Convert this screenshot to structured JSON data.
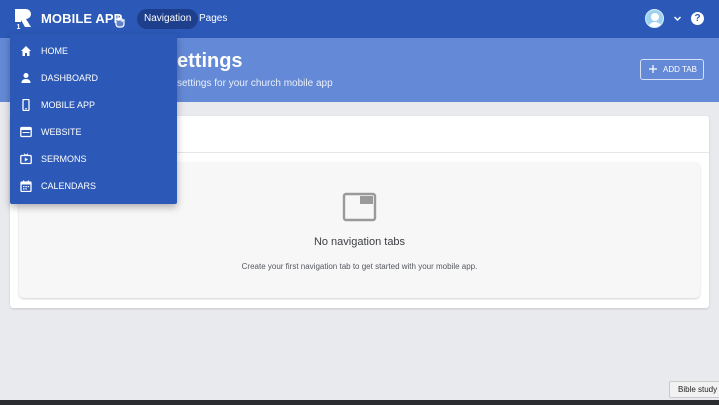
{
  "topbar": {
    "app_title": "MOBILE APP",
    "nav_items": [
      "Navigation",
      "Pages"
    ],
    "help_label": "?"
  },
  "header": {
    "title_visible": "ettings",
    "subtitle_visible": "settings for your church mobile app",
    "add_tab_label": "ADD TAB"
  },
  "menu": {
    "items": [
      {
        "label": "HOME",
        "icon": "home-icon"
      },
      {
        "label": "DASHBOARD",
        "icon": "person-icon"
      },
      {
        "label": "MOBILE APP",
        "icon": "phone-icon"
      },
      {
        "label": "WEBSITE",
        "icon": "browser-icon"
      },
      {
        "label": "SERMONS",
        "icon": "video-icon"
      },
      {
        "label": "CALENDARS",
        "icon": "calendar-icon"
      }
    ]
  },
  "empty_state": {
    "title": "No navigation tabs",
    "message": "Create your first navigation tab to get started with your mobile app."
  },
  "tooltip": "Bible study",
  "colors": {
    "topbar": "#2c59b8",
    "header_band": "#6489d6",
    "nav_pill": "#1d3f8c",
    "page_bg": "#e9eaed"
  }
}
